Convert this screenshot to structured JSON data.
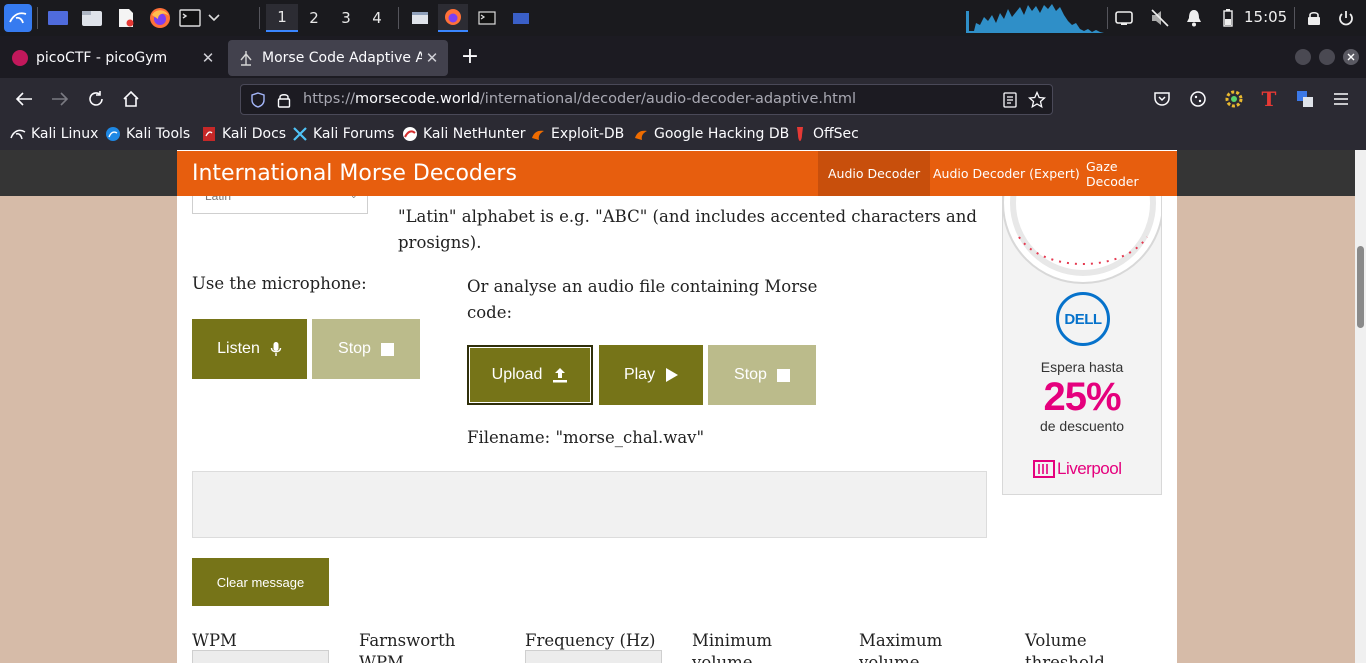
{
  "panel": {
    "workspaces": [
      "1",
      "2",
      "3",
      "4"
    ],
    "active_workspace": "1",
    "clock": "15:05",
    "icons": [
      "kali-menu-icon",
      "desktop-icon",
      "file-manager-icon",
      "text-editor-icon",
      "firefox-icon",
      "terminal-icon",
      "chevron-down-icon",
      "network-icon",
      "mute-icon",
      "notifications-icon",
      "battery-icon",
      "lock-icon",
      "power-icon"
    ]
  },
  "browser": {
    "tabs": [
      {
        "title": "picoCTF - picoGym",
        "active": false
      },
      {
        "title": "Morse Code Adaptive Aud",
        "active": true
      }
    ],
    "url_scheme": "https://",
    "url_host": "morsecode.world",
    "url_path": "/international/decoder/audio-decoder-adaptive.html",
    "bookmarks": [
      "Kali Linux",
      "Kali Tools",
      "Kali Docs",
      "Kali Forums",
      "Kali NetHunter",
      "Exploit-DB",
      "Google Hacking DB",
      "OffSec"
    ]
  },
  "site": {
    "title": "International Morse Decoders",
    "nav": [
      {
        "label": "Audio Decoder",
        "active": true
      },
      {
        "label": "Audio Decoder (Expert)",
        "active": false
      },
      {
        "label": "Gaze Decoder",
        "active": false
      }
    ],
    "accent": "#e75e0e",
    "button_color": "#767418"
  },
  "main": {
    "alphabet_select": "Latin",
    "description_line1": "\"Latin\" alphabet is e.g. \"ABC\" (and includes accented characters and",
    "description_line2": "prosigns).",
    "mic_label": "Use the microphone:",
    "file_label": "Or analyse an audio file containing Morse code:",
    "listen_label": "Listen",
    "stop_label": "Stop",
    "upload_label": "Upload",
    "play_label": "Play",
    "file_stop_label": "Stop",
    "filename": "Filename: \"morse_chal.wav\"",
    "clear_label": "Clear message",
    "params": [
      {
        "line1": "WPM",
        "line2": ""
      },
      {
        "line1": "Farnsworth",
        "line2": "WPM"
      },
      {
        "line1": "Frequency (Hz)",
        "line2": ""
      },
      {
        "line1": "Minimum",
        "line2": "volume"
      },
      {
        "line1": "Maximum",
        "line2": "volume"
      },
      {
        "line1": "Volume",
        "line2": "threshold"
      }
    ]
  },
  "ad": {
    "brand": "DELL",
    "line1": "Espera hasta",
    "percent": "25%",
    "line2": "de descuento",
    "store": "Liverpool"
  }
}
